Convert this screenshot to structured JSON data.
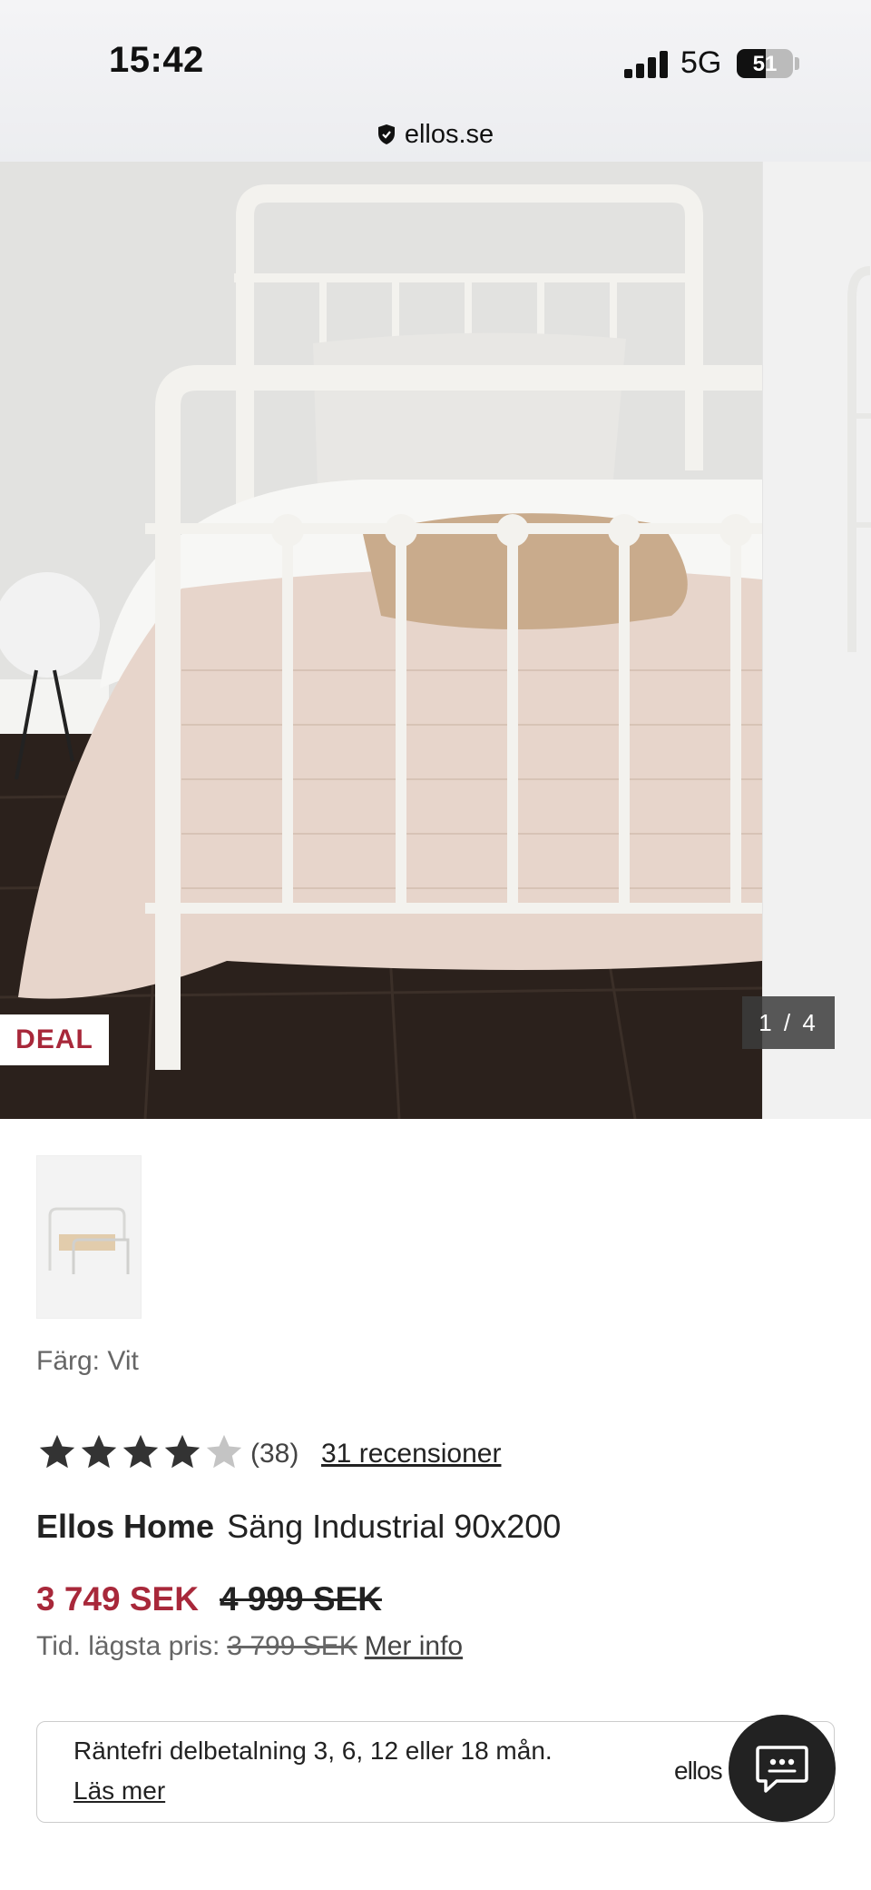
{
  "status_bar": {
    "time": "15:42",
    "network": "5G",
    "battery": "51"
  },
  "browser": {
    "domain": "ellos.se"
  },
  "gallery": {
    "badge": "DEAL",
    "counter": "1 / 4"
  },
  "product": {
    "color_label": "Färg: Vit",
    "rating": 4,
    "rating_max": 5,
    "rating_count": "(38)",
    "reviews_link": "31 recensioner",
    "brand": "Ellos Home",
    "name": "Säng Industrial 90x200",
    "price": "3 749 SEK",
    "original_price": "4 999 SEK",
    "lowest_price_label": "Tid. lägsta pris:",
    "lowest_price_value": "3 799 SEK",
    "more_info_link": "Mer info"
  },
  "installment": {
    "text": "Räntefri delbetalning 3, 6, 12 eller 18 mån.",
    "link": "Läs mer",
    "logo": "ellos"
  },
  "colors": {
    "accent": "#a8283a",
    "chat_button": "#222222"
  },
  "icons": {
    "shield": "shield-check-icon",
    "star": "star-icon",
    "chat": "chat-bubble-icon"
  }
}
